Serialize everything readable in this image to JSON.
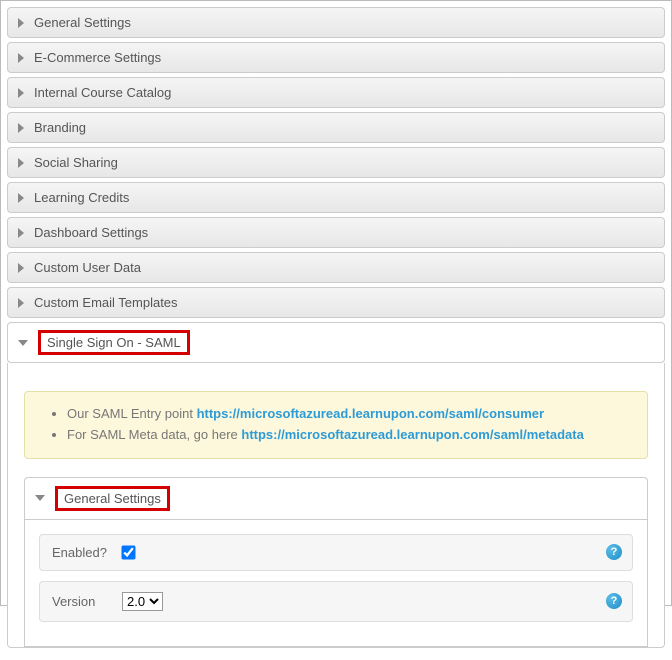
{
  "accordion": [
    {
      "label": "General Settings"
    },
    {
      "label": "E-Commerce Settings"
    },
    {
      "label": "Internal Course Catalog"
    },
    {
      "label": "Branding"
    },
    {
      "label": "Social Sharing"
    },
    {
      "label": "Learning Credits"
    },
    {
      "label": "Dashboard Settings"
    },
    {
      "label": "Custom User Data"
    },
    {
      "label": "Custom Email Templates"
    }
  ],
  "saml": {
    "header": "Single Sign On - SAML",
    "info": {
      "entry_text": "Our SAML Entry point ",
      "entry_url": "https://microsoftazuread.learnupon.com/saml/consumer",
      "meta_text": "For SAML Meta data, go here ",
      "meta_url": "https://microsoftazuread.learnupon.com/saml/metadata"
    },
    "general": {
      "header": "General Settings",
      "enabled_label": "Enabled?",
      "enabled_checked": true,
      "version_label": "Version",
      "version_value": "2.0"
    }
  }
}
